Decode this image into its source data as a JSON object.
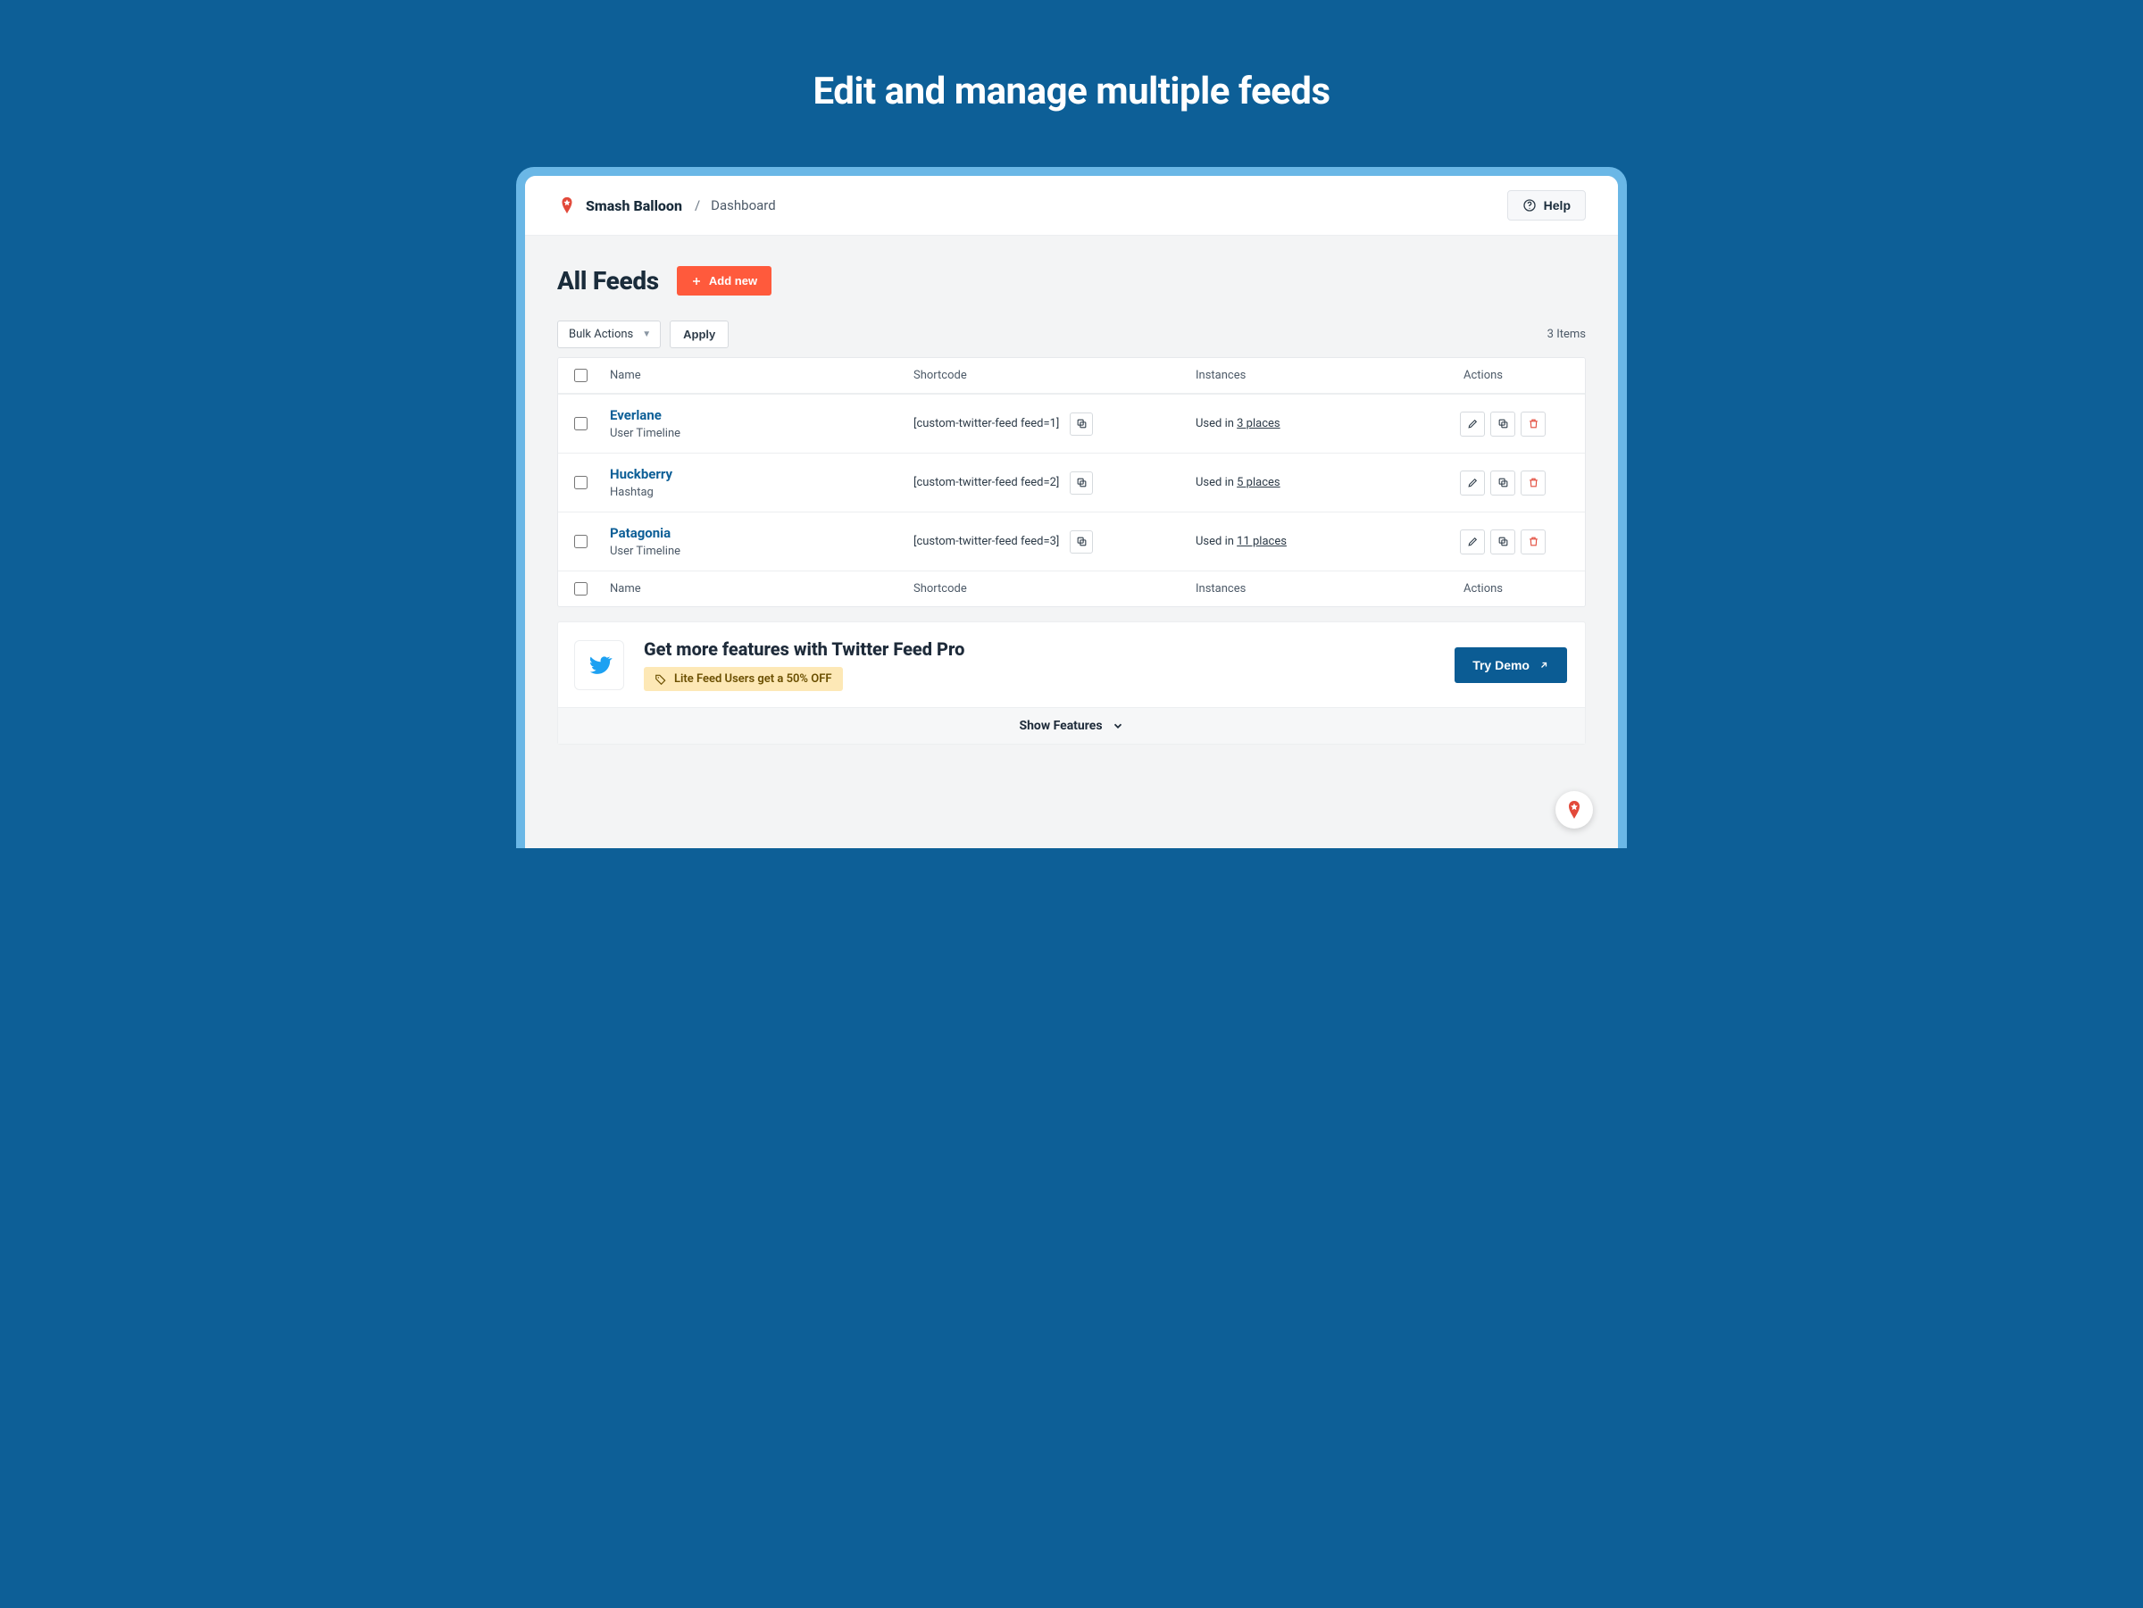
{
  "hero": {
    "title": "Edit and manage multiple feeds"
  },
  "topbar": {
    "brand": "Smash Balloon",
    "separator": "/",
    "crumb": "Dashboard",
    "help": "Help"
  },
  "page": {
    "title": "All Feeds",
    "add_new": "Add new",
    "bulk_actions_label": "Bulk Actions",
    "apply": "Apply",
    "items_count": "3 Items"
  },
  "table": {
    "columns": {
      "name": "Name",
      "shortcode": "Shortcode",
      "instances": "Instances",
      "actions": "Actions"
    },
    "instances_prefix": "Used in ",
    "rows": [
      {
        "name": "Everlane",
        "type": "User Timeline",
        "shortcode": "[custom-twitter-feed feed=1]",
        "places": "3 places"
      },
      {
        "name": "Huckberry",
        "type": "Hashtag",
        "shortcode": "[custom-twitter-feed feed=2]",
        "places": "5 places"
      },
      {
        "name": "Patagonia",
        "type": "User Timeline",
        "shortcode": "[custom-twitter-feed feed=3]",
        "places": "11 places"
      }
    ]
  },
  "promo": {
    "title": "Get more features with Twitter Feed Pro",
    "badge": "Lite Feed Users get a 50% OFF",
    "cta": "Try Demo",
    "toggle": "Show Features"
  },
  "colors": {
    "accent": "#ff5a3c",
    "brand_blue": "#0b5c94",
    "link": "#0d5f97"
  }
}
